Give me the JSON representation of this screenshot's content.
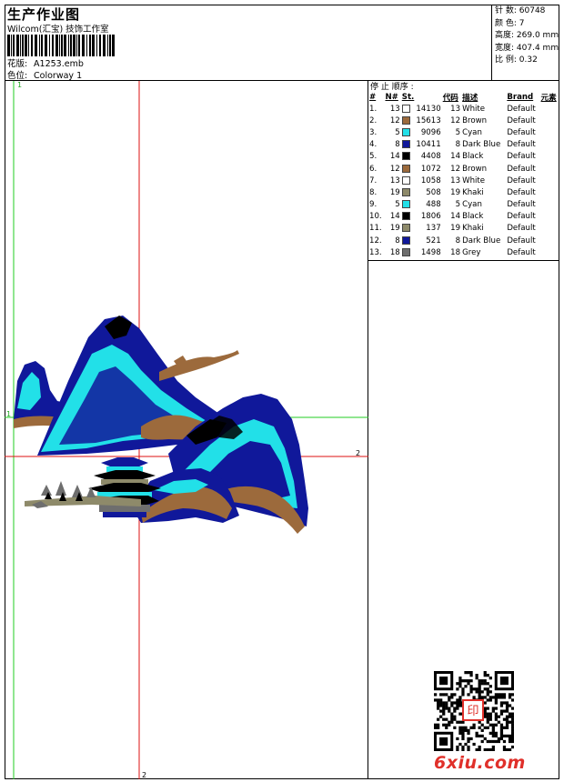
{
  "header": {
    "title": "生产作业图",
    "company": "Wilcom(汇宝) 技饰工作室",
    "design_label": "花版:",
    "design_value": "A1253.emb",
    "colorway_label": "色位:",
    "colorway_value": "Colorway 1"
  },
  "stats": {
    "stitches_label": "针 数:",
    "stitches_value": "60748",
    "colors_label": "颜 色:",
    "colors_value": "7",
    "height_label": "高度:",
    "height_value": "269.0 mm",
    "width_label": "宽度:",
    "width_value": "407.4 mm",
    "scale_label": "比 例:",
    "scale_value": "0.32"
  },
  "guides": {
    "v_green_label": "1",
    "h_green_label": "1",
    "h_red_label": "2",
    "v_red_label": "2"
  },
  "stop_sequence": {
    "title": "停 止 顺序 :",
    "headers": {
      "idx": "#",
      "no": "N#",
      "stitches": "St.",
      "code": "代码",
      "desc": "描述",
      "brand": "Brand",
      "element": "元素"
    },
    "rows": [
      {
        "idx": "1.",
        "no": "13",
        "color": "#ffffff",
        "st": "14130",
        "code": "13",
        "desc": "White",
        "brand": "Default"
      },
      {
        "idx": "2.",
        "no": "12",
        "color": "#9c6a3c",
        "st": "15613",
        "code": "12",
        "desc": "Brown",
        "brand": "Default"
      },
      {
        "idx": "3.",
        "no": "5",
        "color": "#22e0e8",
        "st": "9096",
        "code": "5",
        "desc": "Cyan",
        "brand": "Default"
      },
      {
        "idx": "4.",
        "no": "8",
        "color": "#10189a",
        "st": "10411",
        "code": "8",
        "desc": "Dark Blue",
        "brand": "Default"
      },
      {
        "idx": "5.",
        "no": "14",
        "color": "#000000",
        "st": "4408",
        "code": "14",
        "desc": "Black",
        "brand": "Default"
      },
      {
        "idx": "6.",
        "no": "12",
        "color": "#9c6a3c",
        "st": "1072",
        "code": "12",
        "desc": "Brown",
        "brand": "Default"
      },
      {
        "idx": "7.",
        "no": "13",
        "color": "#ffffff",
        "st": "1058",
        "code": "13",
        "desc": "White",
        "brand": "Default"
      },
      {
        "idx": "8.",
        "no": "19",
        "color": "#8e8a6a",
        "st": "508",
        "code": "19",
        "desc": "Khaki",
        "brand": "Default"
      },
      {
        "idx": "9.",
        "no": "5",
        "color": "#22e0e8",
        "st": "488",
        "code": "5",
        "desc": "Cyan",
        "brand": "Default"
      },
      {
        "idx": "10.",
        "no": "14",
        "color": "#000000",
        "st": "1806",
        "code": "14",
        "desc": "Black",
        "brand": "Default"
      },
      {
        "idx": "11.",
        "no": "19",
        "color": "#8e8a6a",
        "st": "137",
        "code": "19",
        "desc": "Khaki",
        "brand": "Default"
      },
      {
        "idx": "12.",
        "no": "8",
        "color": "#10189a",
        "st": "521",
        "code": "8",
        "desc": "Dark Blue",
        "brand": "Default"
      },
      {
        "idx": "13.",
        "no": "18",
        "color": "#6e6e6e",
        "st": "1498",
        "code": "18",
        "desc": "Grey",
        "brand": "Default"
      }
    ]
  },
  "watermark": {
    "text": "6xiu.com",
    "seal_text": "印"
  },
  "colors": {
    "guide_green": "#22cc22",
    "guide_red": "#dd1111",
    "watermark_red": "#e0302a"
  },
  "icons": {
    "qr": "qr-code-icon",
    "barcode": "barcode-icon"
  }
}
